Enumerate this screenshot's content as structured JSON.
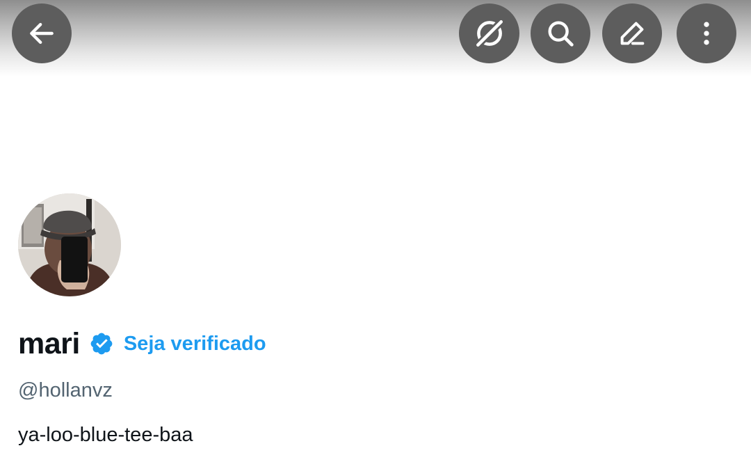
{
  "toolbar": {
    "buttons": [
      {
        "icon": "back-arrow-icon"
      },
      {
        "icon": "grok-icon"
      },
      {
        "icon": "search-icon"
      },
      {
        "icon": "edit-icon"
      },
      {
        "icon": "more-vertical-icon"
      }
    ],
    "button_color": "#5d5d5d"
  },
  "profile": {
    "display_name": "mari",
    "verified": true,
    "verified_badge_color": "#1d9bf0",
    "get_verified_label": "Seja verificado",
    "handle": "@hollanvz",
    "bio": "ya-loo-blue-tee-baa"
  },
  "colors": {
    "text_primary": "#0f1419",
    "text_secondary": "#536471",
    "accent": "#1d9bf0"
  }
}
